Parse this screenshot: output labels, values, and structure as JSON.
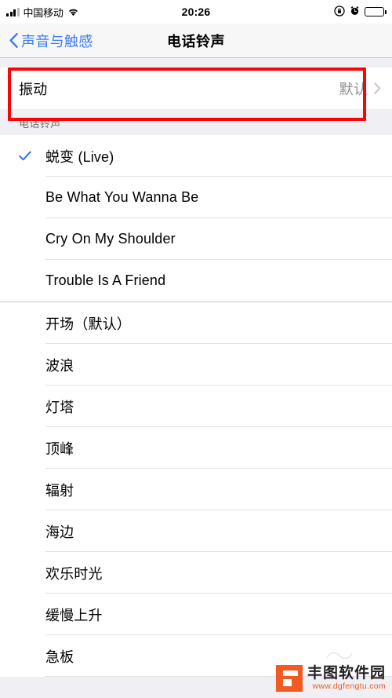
{
  "status_bar": {
    "carrier": "中国移动",
    "time": "20:26",
    "signal_icon": "signal-bars-icon",
    "wifi_icon": "wifi-icon",
    "rotation_lock_icon": "rotation-lock-icon",
    "alarm_icon": "alarm-clock-icon",
    "battery_icon": "battery-icon"
  },
  "nav": {
    "back_label": "声音与触感",
    "back_icon": "chevron-left-icon",
    "title": "电话铃声",
    "accent_color": "#3c7cf3"
  },
  "vibration": {
    "label": "振动",
    "value": "默认",
    "disclosure_icon": "chevron-right-icon"
  },
  "ringtones": {
    "section_header": "电话铃声",
    "check_icon": "checkmark-icon",
    "check_color": "#3478f6",
    "custom": [
      {
        "name": "蜕变 (Live)",
        "selected": true
      },
      {
        "name": "Be What You Wanna Be",
        "selected": false
      },
      {
        "name": "Cry On My Shoulder",
        "selected": false
      },
      {
        "name": "Trouble Is A Friend",
        "selected": false
      }
    ],
    "system": [
      {
        "name": "开场（默认）",
        "selected": false
      },
      {
        "name": "波浪",
        "selected": false
      },
      {
        "name": "灯塔",
        "selected": false
      },
      {
        "name": "顶峰",
        "selected": false
      },
      {
        "name": "辐射",
        "selected": false
      },
      {
        "name": "海边",
        "selected": false
      },
      {
        "name": "欢乐时光",
        "selected": false
      },
      {
        "name": "缓慢上升",
        "selected": false
      },
      {
        "name": "急板",
        "selected": false
      }
    ]
  },
  "annotation": {
    "color": "#fb0407",
    "target": "振动"
  },
  "watermark": {
    "name": "丰图软件园",
    "url": "www.dgfengtu.com",
    "brand_color": "#f05a23"
  }
}
